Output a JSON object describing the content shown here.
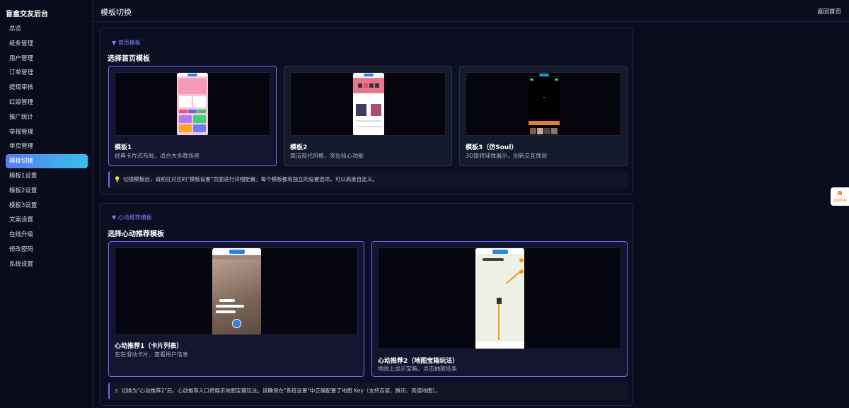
{
  "app": {
    "brand": "盲盒交友后台",
    "page_title": "模板切换",
    "back_label": "返回首页"
  },
  "sidebar": {
    "items": [
      {
        "label": "总览"
      },
      {
        "label": "纸条管理"
      },
      {
        "label": "用户管理"
      },
      {
        "label": "订单管理"
      },
      {
        "label": "提现审核"
      },
      {
        "label": "红娘管理"
      },
      {
        "label": "推广统计"
      },
      {
        "label": "举报管理"
      },
      {
        "label": "单页管理"
      },
      {
        "label": "模板切换",
        "active": true
      },
      {
        "label": "模板1设置"
      },
      {
        "label": "模板2设置"
      },
      {
        "label": "模板3设置"
      },
      {
        "label": "文案设置"
      },
      {
        "label": "在线升级"
      },
      {
        "label": "修改密码"
      },
      {
        "label": "系统设置"
      }
    ]
  },
  "home_section": {
    "toggle": "▼ 首页模板",
    "title": "选择首页模板",
    "cards": [
      {
        "name": "模板1",
        "desc": "经典卡片式布局，适合大多数场景",
        "selected": true
      },
      {
        "name": "模板2",
        "desc": "简洁现代风格，突出核心功能",
        "selected": false
      },
      {
        "name": "模板3（仿Soul）",
        "desc": "3D旋转球体展示，创新交互体验",
        "selected": false
      }
    ],
    "tip_icon": "💡",
    "tip": "切换模板后，请前往对应的\"模板设置\"页面进行详细配置。每个模板都有独立的设置选项，可以高度自定义。"
  },
  "heart_section": {
    "toggle": "▼ 心动推荐模板",
    "title": "选择心动推荐模板",
    "cards": [
      {
        "name": "心动推荐1（卡片列表）",
        "desc": "左右滑动卡片，查看用户信息",
        "selected": true
      },
      {
        "name": "心动推荐2（地图宝箱玩法）",
        "desc": "地图上显示宝箱，点击抽取纸条",
        "selected": true
      }
    ],
    "tip_icon": "⚠",
    "tip": "切换为\"心动推荐2\"后，心动推荐入口将展示地图宝箱玩法。请确保在\"系统设置\"中正确配置了地图 Key（支持百度、腾讯、高德地图）。"
  },
  "float_widget": {
    "mark": "a",
    "caption": "1688 AI"
  },
  "colors": {
    "accent": "#6a6cf0",
    "active_gradient_start": "#5b7bf2",
    "active_gradient_end": "#35c2e8"
  }
}
